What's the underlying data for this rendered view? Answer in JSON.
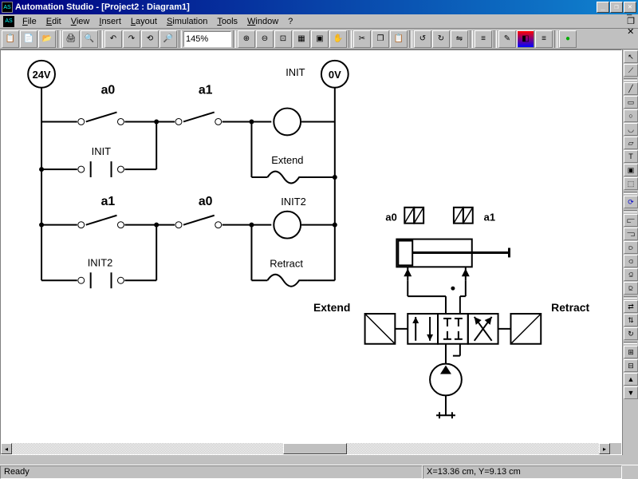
{
  "app": {
    "name": "Automation Studio",
    "doc": "[Project2 : Diagram1]"
  },
  "menu": {
    "file": "File",
    "edit": "Edit",
    "view": "View",
    "insert": "Insert",
    "layout": "Layout",
    "simulation": "Simulation",
    "tools": "Tools",
    "window": "Window",
    "help": "?"
  },
  "toolbar": {
    "zoom": "145%"
  },
  "status": {
    "ready": "Ready",
    "coords": "X=13.36 cm, Y=9.13 cm"
  },
  "labels": {
    "v24": "24V",
    "v0": "0V",
    "a0_top": "a0",
    "a1_top": "a1",
    "init": "INIT",
    "init_mid": "INIT",
    "extend": "Extend",
    "a1_bot": "a1",
    "a0_bot": "a0",
    "init2": "INIT2",
    "init2_mid": "INIT2",
    "retract": "Retract",
    "cyl_a0": "a0",
    "cyl_a1": "a1",
    "valve_extend": "Extend",
    "valve_retract": "Retract"
  }
}
